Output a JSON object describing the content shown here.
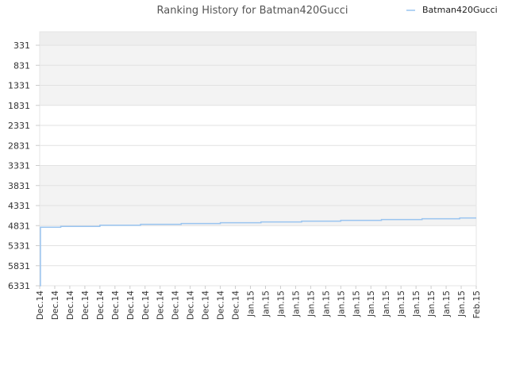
{
  "chart_data": {
    "type": "line",
    "title": "Ranking History for Batman420Gucci",
    "legend_position": "top-right",
    "grid": true,
    "y_inverted": true,
    "ylim": [
      331,
      6331
    ],
    "y_ticks": [
      "331",
      "831",
      "1331",
      "1831",
      "2331",
      "2831",
      "3331",
      "3831",
      "4331",
      "4831",
      "5331",
      "5831",
      "6331"
    ],
    "x_ticks": [
      "Dec.14",
      "Dec.14",
      "Dec.14",
      "Dec.14",
      "Dec.14",
      "Dec.14",
      "Dec.14",
      "Dec.14",
      "Dec.14",
      "Dec.14",
      "Dec.14",
      "Dec.14",
      "Dec.14",
      "Dec.14",
      "Jan.15",
      "Jan.15",
      "Jan.15",
      "Jan.15",
      "Jan.15",
      "Jan.15",
      "Jan.15",
      "Jan.15",
      "Jan.15",
      "Jan.15",
      "Jan.15",
      "Jan.15",
      "Jan.15",
      "Jan.15",
      "Jan.15",
      "Feb.15"
    ],
    "series": [
      {
        "name": "Batman420Gucci",
        "color": "#99c4f0",
        "x_index": [
          0,
          0.05,
          1.4,
          4,
          6.7,
          9.4,
          12,
          14.7,
          17.4,
          20,
          22.7,
          25.4,
          27.9,
          29
        ],
        "values": [
          6331,
          4870,
          4850,
          4820,
          4800,
          4780,
          4760,
          4740,
          4720,
          4700,
          4680,
          4660,
          4640,
          4640
        ]
      }
    ]
  }
}
